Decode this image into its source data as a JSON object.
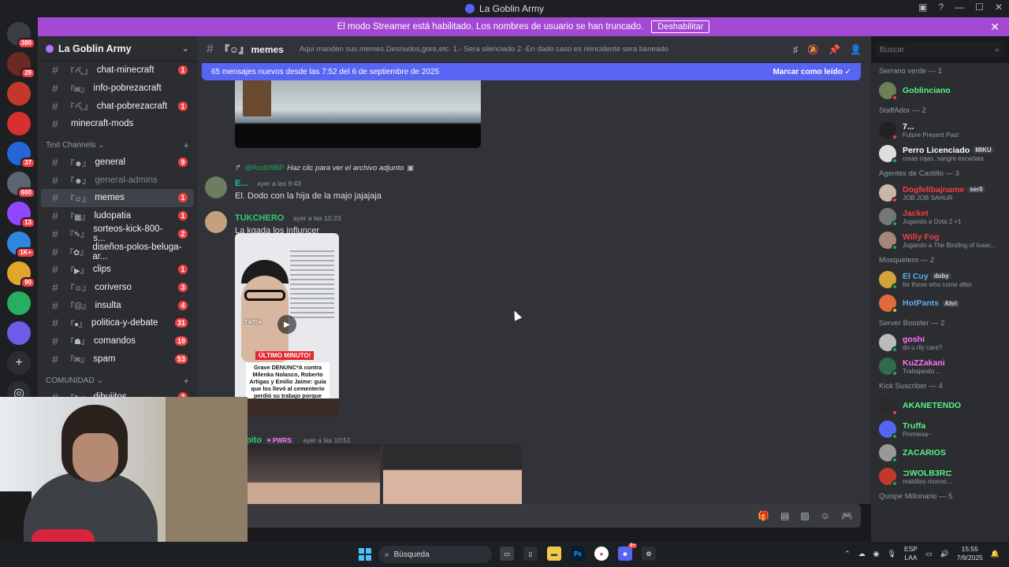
{
  "window": {
    "title": "La Goblin Army"
  },
  "streamer_banner": {
    "text": "El modo Streamer está habilitado. Los nombres de usuario se han truncado.",
    "button": "Deshabilitar"
  },
  "guilds": [
    {
      "badge": "380",
      "color": "#3a3d44"
    },
    {
      "badge": "29",
      "color": "#6b2a21"
    },
    {
      "badge": "",
      "color": "#c0392b"
    },
    {
      "badge": "",
      "color": "#d63031"
    },
    {
      "badge": "37",
      "color": "#2466d6"
    },
    {
      "badge": "660",
      "color": "#5b6470"
    },
    {
      "badge": "13",
      "color": "#9146ff"
    },
    {
      "badge": "1K+",
      "color": "#2e86de"
    },
    {
      "badge": "90",
      "color": "#e1a62b"
    },
    {
      "badge": "",
      "color": "#27ae60"
    },
    {
      "badge": "",
      "color": "#6c5ce7"
    }
  ],
  "server": {
    "name": "La Goblin Army"
  },
  "channels_top": [
    {
      "emoji": "『⛏』",
      "name": "chat-minecraft",
      "count": "1"
    },
    {
      "emoji": "『✉』",
      "name": "info-pobrezacraft",
      "count": ""
    },
    {
      "emoji": "『⛏』",
      "name": "chat-pobrezacraft",
      "count": "1"
    },
    {
      "emoji": "",
      "name": "minecraft-mods",
      "count": ""
    }
  ],
  "category_text": "Text Channels",
  "channels_text": [
    {
      "emoji": "『☻』",
      "name": "general",
      "count": "9",
      "muted": false,
      "active": false
    },
    {
      "emoji": "『☻』",
      "name": "general-admins",
      "count": "",
      "muted": true,
      "active": false
    },
    {
      "emoji": "『☺』",
      "name": "memes",
      "count": "1",
      "muted": false,
      "active": true
    },
    {
      "emoji": "『▦』",
      "name": "ludopatia",
      "count": "1",
      "muted": false,
      "active": false
    },
    {
      "emoji": "『✎』",
      "name": "sorteos-kick-800-s...",
      "count": "2",
      "muted": false,
      "active": false
    },
    {
      "emoji": "『✿』",
      "name": "diseños-polos-beluga-ar...",
      "count": "",
      "muted": false,
      "active": false
    },
    {
      "emoji": "『▶』",
      "name": "clips",
      "count": "1",
      "muted": false,
      "active": false
    },
    {
      "emoji": "『☺』",
      "name": "coriverso",
      "count": "3",
      "muted": false,
      "active": false
    },
    {
      "emoji": "『☹』",
      "name": "insulta",
      "count": "4",
      "muted": false,
      "active": false
    },
    {
      "emoji": "『●』",
      "name": "politica-y-debate",
      "count": "31",
      "muted": false,
      "active": false
    },
    {
      "emoji": "『☗』",
      "name": "comandos",
      "count": "19",
      "muted": false,
      "active": false
    },
    {
      "emoji": "『✉』",
      "name": "spam",
      "count": "53",
      "muted": false,
      "active": false
    }
  ],
  "category_comunidad": "COMUNIDAD",
  "channels_comunidad": [
    {
      "emoji": "『✎』",
      "name": "dibujitos",
      "count": "2"
    }
  ],
  "chat_header": {
    "channel": "『☺』 memes",
    "topic": "Aqui manden sus memes.Desnudos,gore,etc. 1.- Sera silenciado 2.-En dado caso es reincidente sera baneado"
  },
  "search": {
    "placeholder": "Buscar"
  },
  "new_messages": {
    "text": "65 mensajes nuevos desde las 7:52 del 6 de septiembre de 2025",
    "action": "Marcar como leído"
  },
  "messages": [
    {
      "reply_name": "@Rod09BP",
      "reply_text": "Haz clic para ver el archivo adjunto",
      "author": "E...",
      "author_color": "#1abc9c",
      "time": "ayer a las 9:43",
      "text": "El. Dodo con la hija de la majo jajajaja"
    },
    {
      "author": "TUKCHERO",
      "author_color": "#2ecc71",
      "time": "ayer a las 10:23",
      "text": "La kgada los influncer",
      "tiktok": {
        "watermark": "TikTok",
        "ribbon": "ÚLTIMO MINUTO!",
        "headline": "Grave DENUNC*A contra Milenka Nolasco, Roberto Artigas y Emilio Jaime: guía que los llevó al cementerio perdió su trabajo porque hicieron IRL"
      }
    },
    {
      "author": "pito",
      "author_color": "#2ecc71",
      "tag": "PWRS",
      "time": "ayer a las 10:51"
    }
  ],
  "members": {
    "groups": [
      {
        "title": "Serrano verde — 1",
        "items": [
          {
            "name": "Goblinciano",
            "color": "#57f287",
            "status": "",
            "tag": "",
            "st": "#f23f43",
            "av": "#6e7f5a"
          }
        ]
      },
      {
        "title": "StaffAdor — 2",
        "items": [
          {
            "name": "7...",
            "color": "#ffffff",
            "status": "Future Present Past",
            "tag": "",
            "st": "#f23f43",
            "av": "#222"
          },
          {
            "name": "Perro Licenciado",
            "color": "#ffffff",
            "status": "rosas rojas, sangre escarlata",
            "tag": "MIKU",
            "st": "#23a55a",
            "av": "#ddd"
          }
        ]
      },
      {
        "title": "Agentes de Castillo — 3",
        "items": [
          {
            "name": "Dogfellbajname",
            "color": "#f23f43",
            "status": "JOB JOB SAHUR",
            "tag": "ser0",
            "st": "#f23f43",
            "av": "#c8b7a8"
          },
          {
            "name": "Jacket",
            "color": "#f23f43",
            "status": "Jugando a Dota 2 +1",
            "tag": "",
            "st": "#23a55a",
            "av": "#777"
          },
          {
            "name": "Willy Fog",
            "color": "#f23f43",
            "status": "Jugando a The Binding of Isaac...",
            "tag": "",
            "st": "#23a55a",
            "av": "#a7867a"
          }
        ]
      },
      {
        "title": "Mosquetero — 2",
        "items": [
          {
            "name": "El Cuy",
            "color": "#5dadec",
            "status": "for those who come after",
            "tag": "doby",
            "st": "#23a55a",
            "av": "#d4a23c"
          },
          {
            "name": "HotPants",
            "color": "#5dadec",
            "status": "",
            "tag": "Ahri",
            "st": "#f0b232",
            "av": "#e06a3b"
          }
        ]
      },
      {
        "title": "Server Booster — 2",
        "items": [
          {
            "name": "goshi",
            "color": "#ff73fa",
            "status": "do u rlly care?",
            "tag": "",
            "st": "#23a55a",
            "av": "#bbb"
          },
          {
            "name": "KuZZakani",
            "color": "#ff73fa",
            "status": "Trabajando ...",
            "tag": "",
            "st": "#23a55a",
            "av": "#2f6b4f"
          }
        ]
      },
      {
        "title": "Kick Suscriber — 4",
        "items": [
          {
            "name": "AKANETENDO",
            "color": "#57f287",
            "status": "",
            "tag": "",
            "st": "#f23f43",
            "av": "#2a2a2a"
          },
          {
            "name": "Truffa",
            "color": "#57f287",
            "status": "Promesa~",
            "tag": "",
            "st": "#23a55a",
            "av": "#5865f2"
          },
          {
            "name": "ZACARIOS",
            "color": "#57f287",
            "status": "",
            "tag": "",
            "st": "#23a55a",
            "av": "#999"
          },
          {
            "name": "⊐WOLB3R⊏",
            "color": "#57f287",
            "status": "malditos monos...",
            "tag": "",
            "st": "#23a55a",
            "av": "#c0392b"
          }
        ]
      },
      {
        "title": "Quispe Millonario — 5",
        "items": []
      }
    ]
  },
  "taskbar": {
    "search_placeholder": "Búsqueda",
    "lang_top": "ESP",
    "lang_bottom": "LAA",
    "time": "15:55",
    "date": "7/9/2025",
    "discord_badge": "9+"
  }
}
